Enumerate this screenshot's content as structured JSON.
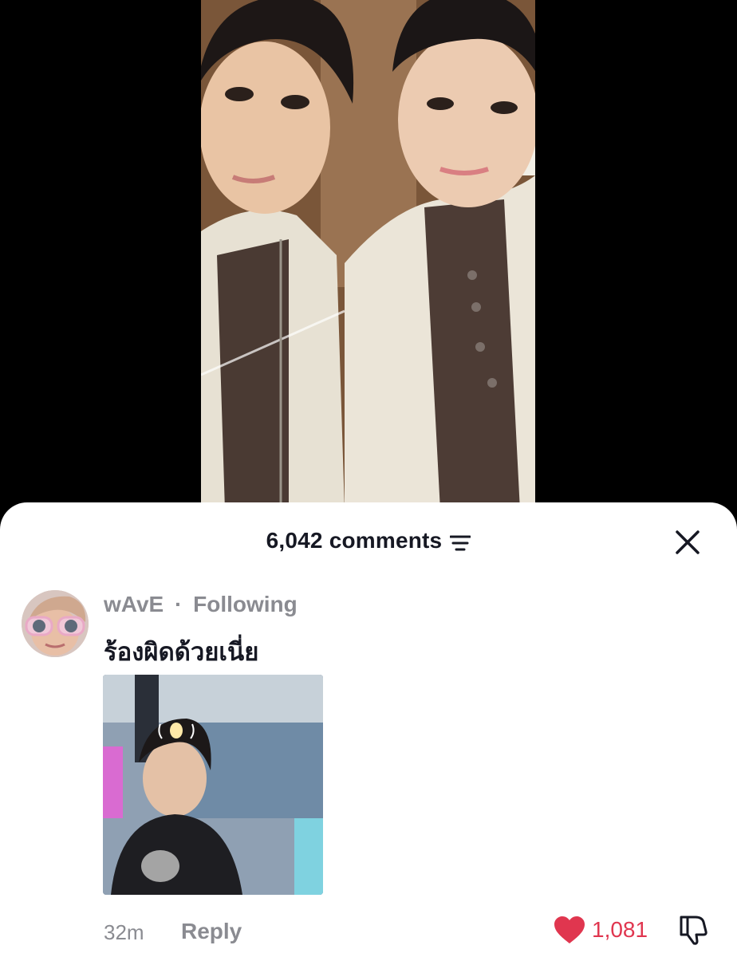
{
  "sheet": {
    "comment_count_label": "6,042 comments"
  },
  "comment": {
    "username": "wAvE",
    "separator": "·",
    "relationship": "Following",
    "text": "ร้องผิดด้วยเนี่ย",
    "time": "32m",
    "reply_label": "Reply",
    "like_count": "1,081",
    "liked": true
  },
  "icons": {
    "filter": "filter-lines-icon",
    "close": "close-x-icon",
    "like": "heart-icon",
    "dislike": "thumbs-down-icon"
  },
  "colors": {
    "like_red": "#e0364f",
    "text_primary": "#161823",
    "text_secondary": "#8a8b91"
  }
}
